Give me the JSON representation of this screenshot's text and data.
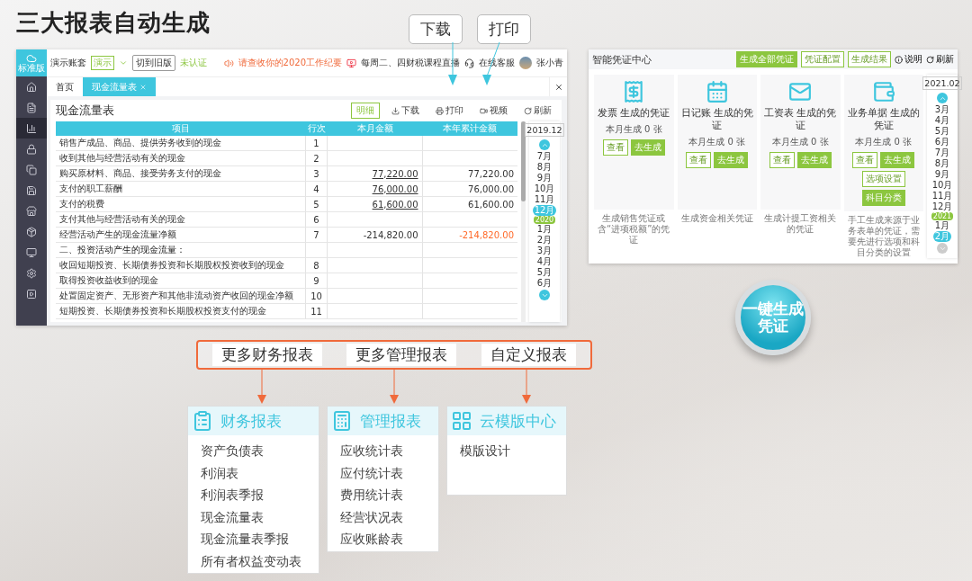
{
  "headline": "三大报表自动生成",
  "callouts": [
    {
      "label": "下载"
    },
    {
      "label": "打印"
    }
  ],
  "app": {
    "logo_label": "标准版",
    "nav_items": [
      {
        "selected": false
      },
      {
        "selected": false
      },
      {
        "selected": true
      },
      {
        "selected": false
      },
      {
        "selected": false
      },
      {
        "selected": false
      },
      {
        "selected": false
      },
      {
        "selected": false
      },
      {
        "selected": false
      },
      {
        "selected": false
      },
      {
        "selected": false
      }
    ],
    "top_bar": {
      "account": "演示账套",
      "account_tag": "演示",
      "switch_button": "切到旧版",
      "certification": "未认证",
      "notice": "请查收你的2020工作纪要",
      "live": "每周二、四财税课程直播",
      "support": "在线客服",
      "user": "张小青"
    },
    "tabs": [
      {
        "label": "首页",
        "selected": false
      },
      {
        "label": "现金流量表",
        "selected": true,
        "closable": true
      }
    ],
    "page_title": "现金流量表",
    "toolbar": [
      {
        "label": "明细",
        "kind": "toggle"
      },
      {
        "label": "下载",
        "kind": "action"
      },
      {
        "label": "打印",
        "kind": "action"
      },
      {
        "label": "视频",
        "kind": "action"
      },
      {
        "label": "刷新",
        "kind": "action"
      }
    ],
    "table": {
      "columns": [
        "项目",
        "行次",
        "本月金额",
        "本年累计金额"
      ],
      "rows": [
        {
          "item": "销售产成品、商品、提供劳务收到的现金",
          "line": "1",
          "kind": "row"
        },
        {
          "item": "收到其他与经营活动有关的现金",
          "line": "2",
          "kind": "row"
        },
        {
          "item": "购买原材料、商品、接受劳务支付的现金",
          "line": "3",
          "month": "77,220.00",
          "year": "77,220.00",
          "linked": true,
          "kind": "row"
        },
        {
          "item": "支付的职工薪酬",
          "line": "4",
          "month": "76,000.00",
          "year": "76,000.00",
          "linked": true,
          "kind": "row"
        },
        {
          "item": "支付的税费",
          "line": "5",
          "month": "61,600.00",
          "year": "61,600.00",
          "linked": true,
          "kind": "row"
        },
        {
          "item": "支付其他与经营活动有关的现金",
          "line": "6",
          "kind": "row"
        },
        {
          "item": "经营活动产生的现金流量净额",
          "line": "7",
          "month": "-214,820.00",
          "year": "-214,820.00",
          "highlight": true,
          "kind": "row"
        },
        {
          "item": "二、投资活动产生的现金流量：",
          "kind": "heading"
        },
        {
          "item": "收回短期投资、长期债券投资和长期股权投资收到的现金",
          "line": "8",
          "kind": "row"
        },
        {
          "item": "取得投资收益收到的现金",
          "line": "9",
          "kind": "row"
        },
        {
          "item": "处置固定资产、无形资产和其他非流动资产收回的现金净额",
          "line": "10",
          "kind": "row"
        },
        {
          "item": "短期投资、长期债券投资和长期股权投资支付的现金",
          "line": "11",
          "kind": "row"
        }
      ]
    },
    "period": {
      "value": "2019.12",
      "months": [
        {
          "kind": "up"
        },
        {
          "kind": "month",
          "label": "7月",
          "selected": false
        },
        {
          "kind": "month",
          "label": "8月",
          "selected": false
        },
        {
          "kind": "month",
          "label": "9月",
          "selected": false
        },
        {
          "kind": "month",
          "label": "10月",
          "selected": false
        },
        {
          "kind": "month",
          "label": "11月",
          "selected": false
        },
        {
          "kind": "month",
          "label": "12月",
          "selected": true
        },
        {
          "kind": "year",
          "label": "2020"
        },
        {
          "kind": "month",
          "label": "1月",
          "selected": false
        },
        {
          "kind": "month",
          "label": "2月",
          "selected": false
        },
        {
          "kind": "month",
          "label": "3月",
          "selected": false
        },
        {
          "kind": "month",
          "label": "4月",
          "selected": false
        },
        {
          "kind": "month",
          "label": "5月",
          "selected": false
        },
        {
          "kind": "month",
          "label": "6月",
          "selected": false
        },
        {
          "kind": "down"
        }
      ]
    }
  },
  "voucher_center": {
    "title": "智能凭证中心",
    "buttons": [
      {
        "label": "生成全部凭证",
        "primary": true
      },
      {
        "label": "凭证配置",
        "primary": false
      },
      {
        "label": "生成结果",
        "primary": false
      }
    ],
    "links": [
      "说明",
      "刷新"
    ],
    "cards": [
      {
        "title": "发票 生成的凭证",
        "count": "本月生成 0 张",
        "buttons": [
          {
            "label": "查看",
            "primary": false
          },
          {
            "label": "去生成",
            "primary": true
          }
        ],
        "description": "生成销售凭证或含“进项税额”的凭证"
      },
      {
        "title": "日记账 生成的凭证",
        "count": "本月生成 0 张",
        "buttons": [
          {
            "label": "查看",
            "primary": false
          },
          {
            "label": "去生成",
            "primary": true
          }
        ],
        "description": "生成资金相关凭证"
      },
      {
        "title": "工资表 生成的凭证",
        "count": "本月生成 0 张",
        "buttons": [
          {
            "label": "查看",
            "primary": false
          },
          {
            "label": "去生成",
            "primary": true
          }
        ],
        "description": "生成计提工资相关的凭证"
      },
      {
        "title": "业务单据 生成的凭证",
        "count": "本月生成 0 张",
        "buttons": [
          {
            "label": "查看",
            "primary": false
          },
          {
            "label": "去生成",
            "primary": true
          },
          {
            "label": "选项设置",
            "primary": false
          },
          {
            "label": "科目分类",
            "primary": true
          }
        ],
        "description": "手工生成来源于业务表单的凭证，需要先进行选项和科目分类的设置"
      }
    ],
    "period": {
      "value": "2021.02",
      "months": [
        {
          "kind": "up"
        },
        {
          "kind": "month",
          "label": "3月",
          "selected": false
        },
        {
          "kind": "month",
          "label": "4月",
          "selected": false
        },
        {
          "kind": "month",
          "label": "5月",
          "selected": false
        },
        {
          "kind": "month",
          "label": "6月",
          "selected": false
        },
        {
          "kind": "month",
          "label": "7月",
          "selected": false
        },
        {
          "kind": "month",
          "label": "8月",
          "selected": false
        },
        {
          "kind": "month",
          "label": "9月",
          "selected": false
        },
        {
          "kind": "month",
          "label": "10月",
          "selected": false
        },
        {
          "kind": "month",
          "label": "11月",
          "selected": false
        },
        {
          "kind": "month",
          "label": "12月",
          "selected": false
        },
        {
          "kind": "year",
          "label": "2021"
        },
        {
          "kind": "month",
          "label": "1月",
          "selected": false
        },
        {
          "kind": "month",
          "label": "2月",
          "selected": true
        },
        {
          "kind": "down"
        }
      ]
    }
  },
  "generate_button": {
    "label": "一键生成凭证"
  },
  "report_categories": {
    "labels": [
      "更多财务报表",
      "更多管理报表",
      "自定义报表"
    ],
    "groups": [
      {
        "title": "财务报表",
        "items": [
          "资产负债表",
          "利润表",
          "利润表季报",
          "现金流量表",
          "现金流量表季报",
          "所有者权益变动表"
        ]
      },
      {
        "title": "管理报表",
        "items": [
          "应收统计表",
          "应付统计表",
          "费用统计表",
          "经营状况表",
          "应收账龄表"
        ]
      },
      {
        "title": "云模版中心",
        "items": [
          "模版设计"
        ]
      }
    ]
  }
}
